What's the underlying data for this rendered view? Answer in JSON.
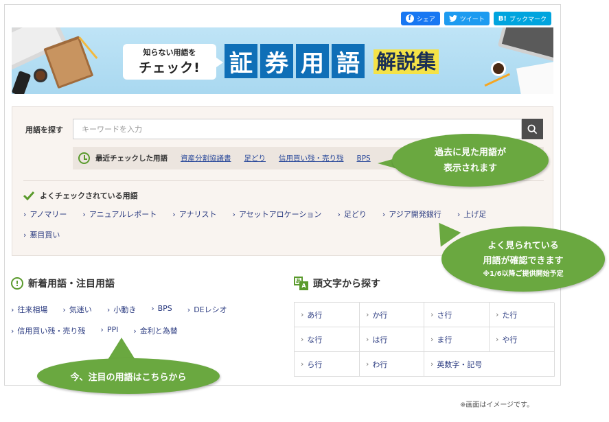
{
  "share": {
    "facebook": "シェア",
    "twitter": "ツイート",
    "hatena_mark": "B!",
    "hatena": "ブックマーク"
  },
  "banner": {
    "bubble_line1": "知らない用語を",
    "bubble_line2": "チェック!",
    "tiles": [
      "証",
      "券",
      "用",
      "語"
    ],
    "subtitle": "解説集"
  },
  "search": {
    "label": "用語を探す",
    "placeholder": "キーワードを入力"
  },
  "recent": {
    "label": "最近チェックした用語",
    "items": [
      "資産分割協議書",
      "足どり",
      "信用買い残・売り残",
      "BPS"
    ]
  },
  "popular": {
    "title": "よくチェックされている用語",
    "items": [
      "アノマリー",
      "アニュアルレポート",
      "アナリスト",
      "アセットアロケーション",
      "足どり",
      "アジア開発銀行",
      "上げ足",
      "悪目買い"
    ]
  },
  "new_terms": {
    "title": "新着用語・注目用語",
    "items": [
      "往来相場",
      "気迷い",
      "小動き",
      "BPS",
      "DEレシオ",
      "信用買い残・売り残",
      "PPI",
      "金利と為替"
    ]
  },
  "kana": {
    "title": "頭文字から探す",
    "items": [
      "あ行",
      "か行",
      "さ行",
      "た行",
      "な行",
      "は行",
      "ま行",
      "や行",
      "ら行",
      "わ行",
      "英数字・記号"
    ]
  },
  "callouts": {
    "recent_line1": "過去に見た用語が",
    "recent_line2": "表示されます",
    "popular_line1": "よく見られている",
    "popular_line2": "用語が確認できます",
    "popular_note": "※1/6以降ご提供開始予定",
    "new": "今、注目の用語はこちらから"
  },
  "footer_note": "※画面はイメージです。",
  "colors": {
    "accent_green": "#6aa840",
    "banner_blue": "#0f6fb7",
    "link": "#2b3b80"
  }
}
